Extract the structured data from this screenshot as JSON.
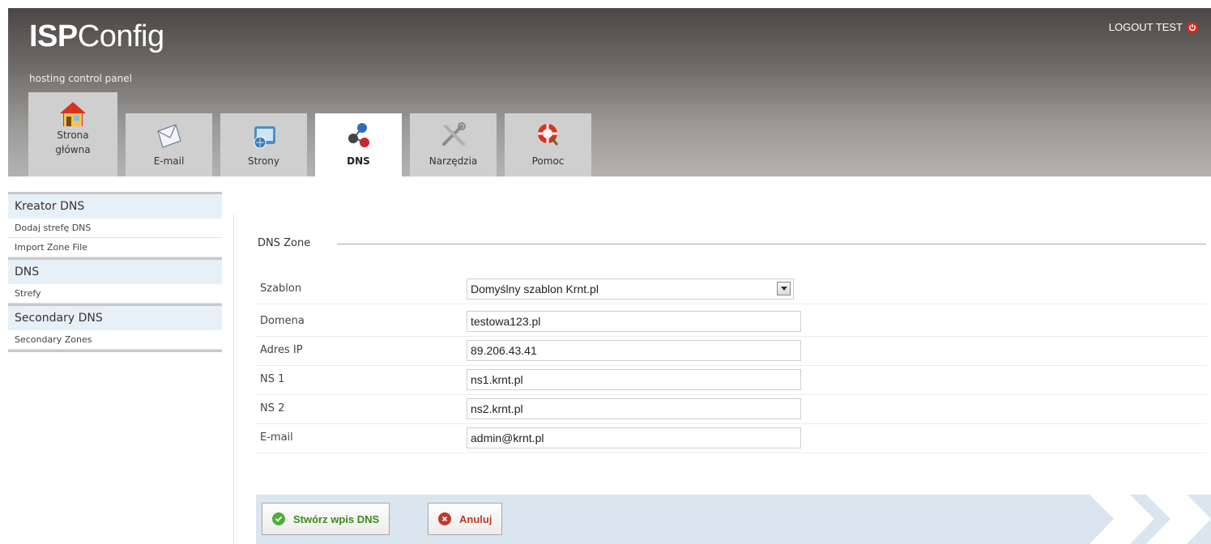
{
  "header": {
    "logo_bold": "ISP",
    "logo_light": "Config",
    "tagline": "hosting control panel",
    "logout_label": "LOGOUT TEST"
  },
  "tabs": [
    {
      "label_line1": "Strona",
      "label_line2": "główna",
      "icon": "home-icon"
    },
    {
      "label": "E-mail",
      "icon": "envelope-icon"
    },
    {
      "label": "Strony",
      "icon": "websites-icon"
    },
    {
      "label": "DNS",
      "icon": "network-icon",
      "active": true
    },
    {
      "label": "Narzędzia",
      "icon": "tools-icon"
    },
    {
      "label": "Pomoc",
      "icon": "lifebuoy-icon"
    }
  ],
  "sidebar": {
    "sections": [
      {
        "title": "Kreator DNS",
        "items": [
          "Dodaj strefę DNS",
          "Import Zone File"
        ]
      },
      {
        "title": "DNS",
        "items": [
          "Strefy"
        ]
      },
      {
        "title": "Secondary DNS",
        "items": [
          "Secondary Zones"
        ]
      }
    ]
  },
  "form": {
    "legend": "DNS Zone",
    "fields": [
      {
        "label": "Szablon",
        "value": "Domyślny szablon Krnt.pl",
        "type": "select"
      },
      {
        "label": "Domena",
        "value": "testowa123.pl"
      },
      {
        "label": "Adres IP",
        "value": "89.206.43.41"
      },
      {
        "label": "NS 1",
        "value": "ns1.krnt.pl"
      },
      {
        "label": "NS 2",
        "value": "ns2.krnt.pl"
      },
      {
        "label": "E-mail",
        "value": "admin@krnt.pl"
      }
    ]
  },
  "buttons": {
    "create_label": "Stwórz wpis DNS",
    "cancel_label": "Anuluj"
  },
  "colors": {
    "accent_green": "#3e8a1c",
    "cancel_red": "#c0392b",
    "bar_blue": "#dae5ef",
    "sidebar_blue": "#e8f0f7"
  }
}
